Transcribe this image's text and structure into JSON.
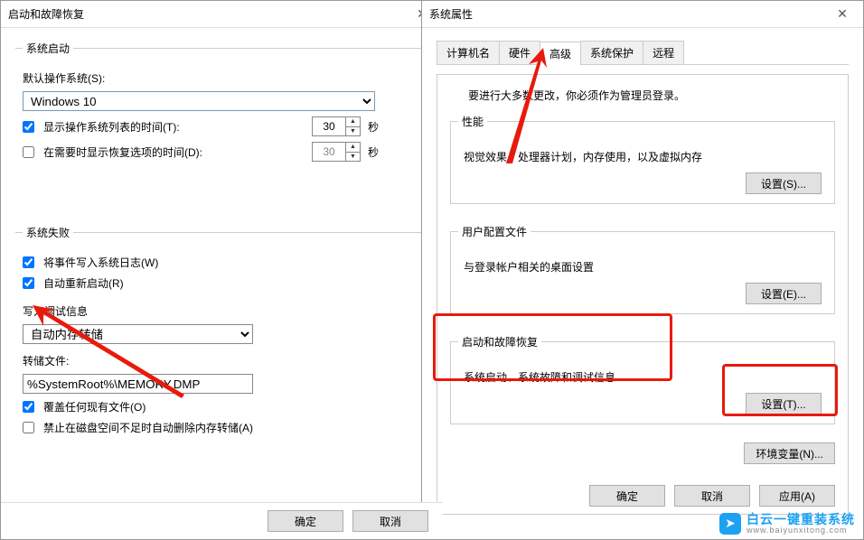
{
  "left": {
    "title": "启动和故障恢复",
    "group_system_start": "系统启动",
    "default_os_label": "默认操作系统(S):",
    "default_os_value": "Windows 10",
    "show_oslist_label": "显示操作系统列表的时间(T):",
    "show_oslist_checked": true,
    "show_oslist_seconds": "30",
    "show_recovery_label": "在需要时显示恢复选项的时间(D):",
    "show_recovery_checked": false,
    "show_recovery_seconds": "30",
    "sec_unit": "秒",
    "group_system_fail": "系统失败",
    "write_event_label": "将事件写入系统日志(W)",
    "auto_restart_label": "自动重新启动(R)",
    "debug_info_label": "写入调试信息",
    "dump_type": "自动内存转储",
    "dump_file_label": "转储文件:",
    "dump_file_path": "%SystemRoot%\\MEMORY.DMP",
    "overwrite_label": "覆盖任何现有文件(O)",
    "disable_autodelete_label": "禁止在磁盘空间不足时自动删除内存转储(A)",
    "ok": "确定",
    "cancel": "取消"
  },
  "right": {
    "title": "系统属性",
    "tabs": {
      "computer_name": "计算机名",
      "hardware": "硬件",
      "advanced": "高级",
      "protection": "系统保护",
      "remote": "远程"
    },
    "note": "要进行大多数更改，你必须作为管理员登录。",
    "perf": {
      "legend": "性能",
      "desc": "视觉效果，处理器计划，内存使用，以及虚拟内存",
      "btn": "设置(S)..."
    },
    "profile": {
      "legend": "用户配置文件",
      "desc": "与登录帐户相关的桌面设置",
      "btn": "设置(E)..."
    },
    "startup": {
      "legend": "启动和故障恢复",
      "desc": "系统启动、系统故障和调试信息",
      "btn": "设置(T)..."
    },
    "envvar_btn": "环境变量(N)...",
    "ok": "确定",
    "cancel": "取消",
    "apply": "应用(A)"
  },
  "watermark": {
    "main": "白云一键重装系统",
    "sub": "www.baiyunxitong.com"
  }
}
